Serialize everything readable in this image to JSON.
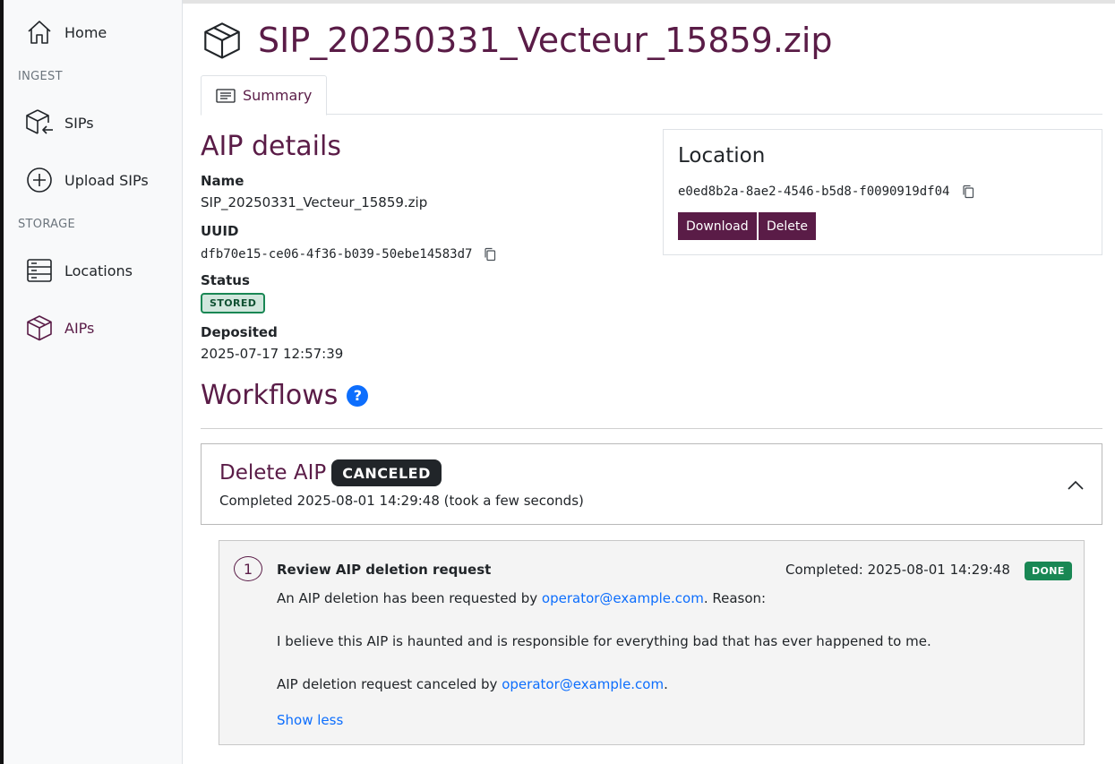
{
  "sidebar": {
    "home": {
      "label": "Home",
      "icon": "home-icon"
    },
    "sections": {
      "ingest": "INGEST",
      "storage": "STORAGE"
    },
    "sips": {
      "label": "SIPs",
      "icon": "package-in-icon"
    },
    "upload": {
      "label": "Upload SIPs",
      "icon": "plus-circle-icon"
    },
    "locations": {
      "label": "Locations",
      "icon": "server-icon"
    },
    "aips": {
      "label": "AIPs",
      "icon": "box-icon",
      "active": true
    }
  },
  "header": {
    "title": "SIP_20250331_Vecteur_15859.zip",
    "icon": "box-icon"
  },
  "tabs": [
    {
      "label": "Summary",
      "icon": "summary-icon",
      "active": true
    }
  ],
  "details": {
    "heading": "AIP details",
    "name_label": "Name",
    "name_value": "SIP_20250331_Vecteur_15859.zip",
    "uuid_label": "UUID",
    "uuid_value": "dfb70e15-ce06-4f36-b039-50ebe14583d7",
    "status_label": "Status",
    "status_value": "STORED",
    "deposited_label": "Deposited",
    "deposited_value": "2025-07-17 12:57:39"
  },
  "location": {
    "heading": "Location",
    "uuid": "e0ed8b2a-8ae2-4546-b5d8-f0090919df04",
    "download_label": "Download",
    "delete_label": "Delete"
  },
  "workflows": {
    "heading": "Workflows",
    "help_glyph": "?",
    "items": [
      {
        "title": "Delete AIP",
        "status": "CANCELED",
        "subtitle": "Completed 2025-08-01 14:29:48 (took a few seconds)",
        "tasks": [
          {
            "step": "1",
            "title": "Review AIP deletion request",
            "completed": "Completed: 2025-08-01 14:29:48",
            "status": "DONE",
            "line1_prefix": "An AIP deletion has been requested by ",
            "line1_link": "operator@example.com",
            "line1_suffix": ". Reason:",
            "reason": "I believe this AIP is haunted and is responsible for everything bad that has ever happened to me.",
            "line3_prefix": "AIP deletion request canceled by ",
            "line3_link": "operator@example.com",
            "line3_suffix": ".",
            "toggle_label": "Show less"
          }
        ]
      }
    ]
  },
  "colors": {
    "brand": "#5a1c47",
    "link": "#0d6efd",
    "success": "#198754",
    "dark": "#212529"
  }
}
